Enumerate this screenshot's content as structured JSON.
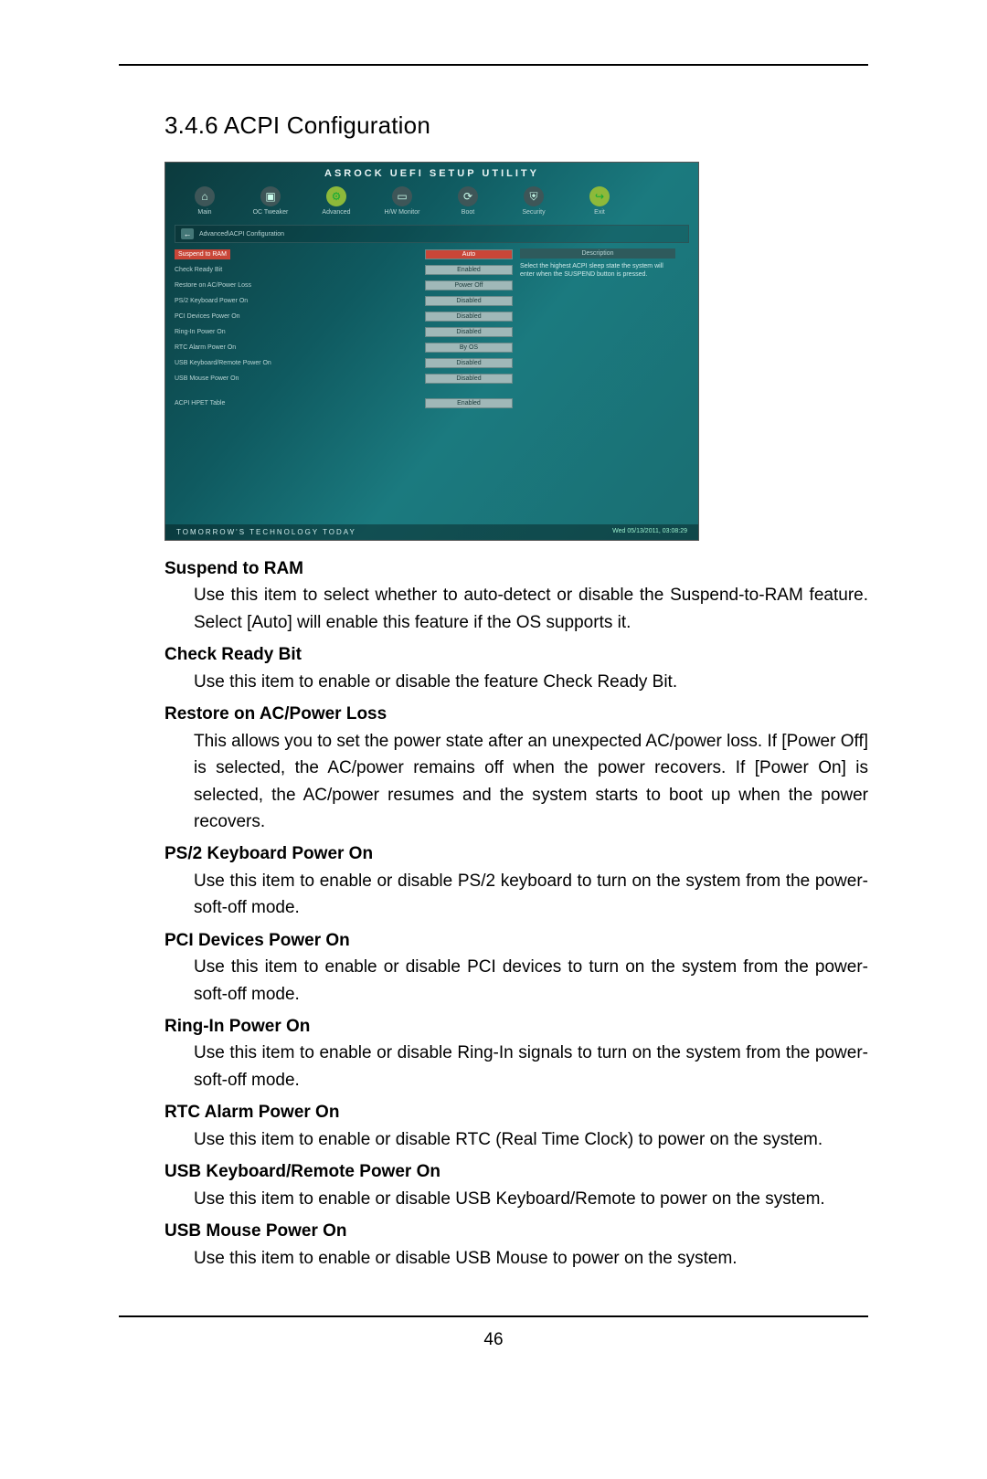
{
  "page_number": "46",
  "section_heading": "3.4.6  ACPI Configuration",
  "bios": {
    "title": "ASROCK UEFI SETUP UTILITY",
    "menu": [
      {
        "label": "Main",
        "glyph": "⌂",
        "style": "gray",
        "name": "menu-main"
      },
      {
        "label": "OC Tweaker",
        "glyph": "▣",
        "style": "gray",
        "name": "menu-oc-tweaker"
      },
      {
        "label": "Advanced",
        "glyph": "⚙",
        "style": "green",
        "name": "menu-advanced"
      },
      {
        "label": "H/W Monitor",
        "glyph": "▭",
        "style": "gray",
        "name": "menu-hw-monitor"
      },
      {
        "label": "Boot",
        "glyph": "⟳",
        "style": "gray",
        "name": "menu-boot"
      },
      {
        "label": "Security",
        "glyph": "⛨",
        "style": "gray",
        "name": "menu-security"
      },
      {
        "label": "Exit",
        "glyph": "↪",
        "style": "green",
        "name": "menu-exit"
      }
    ],
    "breadcrumb": "Advanced\\ACPI Configuration",
    "rows": [
      {
        "key": "Suspend to RAM",
        "val": "Auto",
        "selected": true
      },
      {
        "key": "Check Ready Bit",
        "val": "Enabled",
        "selected": false
      },
      {
        "key": "Restore on AC/Power Loss",
        "val": "Power Off",
        "selected": false
      },
      {
        "key": "PS/2 Keyboard Power On",
        "val": "Disabled",
        "selected": false
      },
      {
        "key": "PCI Devices Power On",
        "val": "Disabled",
        "selected": false
      },
      {
        "key": "Ring-In Power On",
        "val": "Disabled",
        "selected": false
      },
      {
        "key": "RTC Alarm Power On",
        "val": "By OS",
        "selected": false
      },
      {
        "key": "USB Keyboard/Remote Power On",
        "val": "Disabled",
        "selected": false
      },
      {
        "key": "USB Mouse Power On",
        "val": "Disabled",
        "selected": false
      },
      {
        "key": "",
        "val": "",
        "selected": false
      },
      {
        "key": "ACPI HPET Table",
        "val": "Enabled",
        "selected": false
      }
    ],
    "help_title": "Description",
    "help_text": "Select the highest ACPI sleep state the system will enter when the SUSPEND button is pressed.",
    "footer_left": "TOMORROW'S TECHNOLOGY TODAY",
    "footer_right": "Wed 05/13/2011, 03:08:29"
  },
  "items": [
    {
      "head": "Suspend to RAM",
      "desc": "Use this item to select whether to auto-detect or disable the Suspend-to-RAM feature. Select [Auto] will enable this feature if the OS supports it."
    },
    {
      "head": "Check Ready Bit",
      "desc": "Use this item to enable or disable the feature Check Ready Bit."
    },
    {
      "head": "Restore on AC/Power Loss",
      "desc": "This allows you to set the power state after an unexpected AC/power loss. If [Power Off] is selected, the AC/power remains off when the power recovers. If [Power On] is selected, the AC/power resumes and the system starts to boot up when the power recovers."
    },
    {
      "head": "PS/2 Keyboard Power On",
      "desc": "Use this item to enable or disable PS/2 keyboard to turn on the system from the power-soft-off mode."
    },
    {
      "head": "PCI Devices Power On",
      "desc": "Use this item to enable or disable PCI devices to turn on the system from the power-soft-off mode."
    },
    {
      "head": "Ring-In Power On",
      "desc": "Use this item to enable or disable Ring-In signals to turn on the system from the power-soft-off mode."
    },
    {
      "head": "RTC Alarm Power On",
      "desc": "Use this item to enable or disable RTC (Real Time Clock) to power on the system."
    },
    {
      "head": "USB Keyboard/Remote Power On",
      "desc": "Use this item to enable or disable USB Keyboard/Remote to power on the system."
    },
    {
      "head": "USB Mouse Power On",
      "desc": "Use this item to enable or disable USB Mouse to power on the system."
    }
  ]
}
